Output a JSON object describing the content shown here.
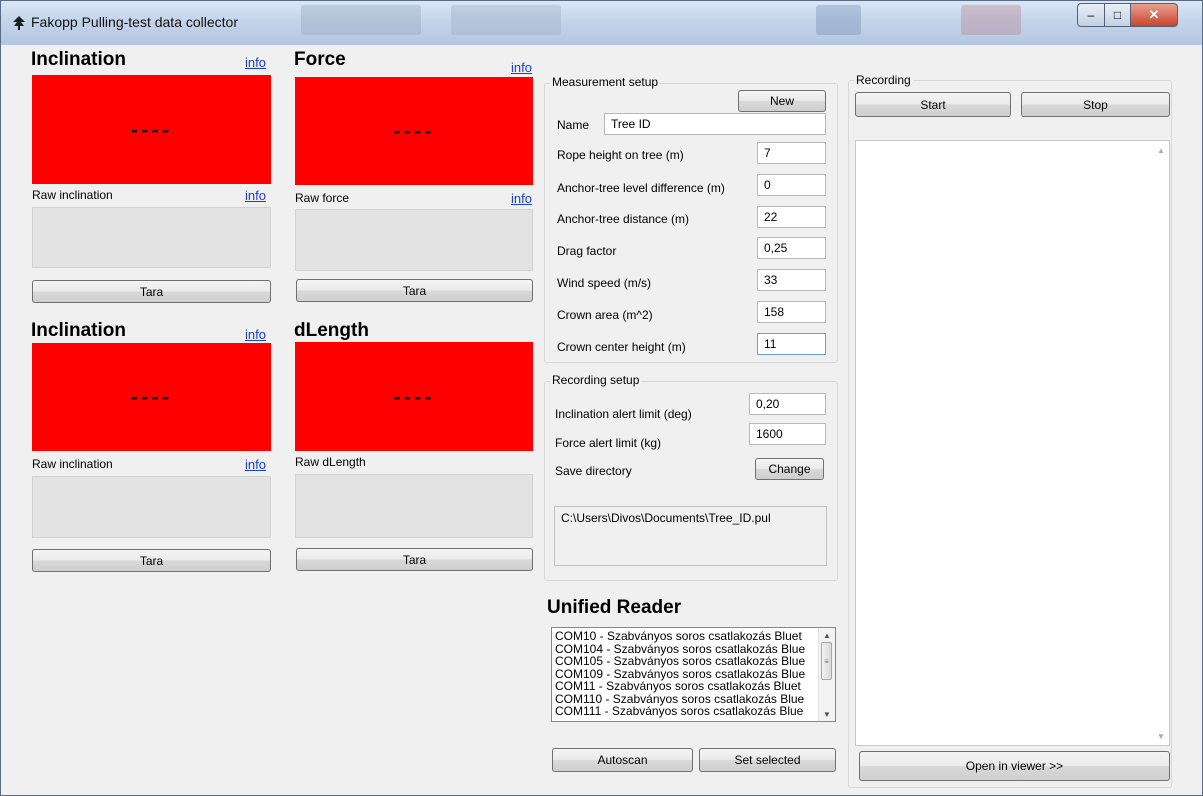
{
  "window": {
    "title": "Fakopp Pulling-test data collector",
    "controls": {
      "minimize": "–",
      "maximize": "□",
      "close": "✕"
    }
  },
  "panels": [
    {
      "title": "Inclination",
      "info": "info",
      "value": "----",
      "raw_label": "Raw inclination",
      "raw_info": "info",
      "tara": "Tara"
    },
    {
      "title": "Force",
      "info": "info",
      "value": "----",
      "raw_label": "Raw force",
      "raw_info": "info",
      "tara": "Tara"
    },
    {
      "title": "Inclination",
      "info": "info",
      "value": "----",
      "raw_label": "Raw inclination",
      "raw_info": "info",
      "tara": "Tara"
    },
    {
      "title": "dLength",
      "value": "----",
      "raw_label": "Raw dLength",
      "tara": "Tara"
    }
  ],
  "measurement_setup": {
    "title": "Measurement setup",
    "new_button": "New",
    "name_label": "Name",
    "name_value": "Tree ID",
    "fields": [
      {
        "label": "Rope height on tree (m)",
        "value": "7"
      },
      {
        "label": "Anchor-tree level difference (m)",
        "value": "0"
      },
      {
        "label": "Anchor-tree distance (m)",
        "value": "22"
      },
      {
        "label": "Drag factor",
        "value": "0,25"
      },
      {
        "label": "Wind speed (m/s)",
        "value": "33"
      },
      {
        "label": "Crown area (m^2)",
        "value": "158"
      },
      {
        "label": "Crown center height (m)",
        "value": "11"
      }
    ]
  },
  "recording_setup": {
    "title": "Recording setup",
    "fields": [
      {
        "label": "Inclination alert limit (deg)",
        "value": "0,20"
      },
      {
        "label": "Force alert limit (kg)",
        "value": "1600"
      }
    ],
    "save_directory_label": "Save directory",
    "change_button": "Change",
    "path": "C:\\Users\\Divos\\Documents\\Tree_ID.pul"
  },
  "unified_reader": {
    "title": "Unified Reader",
    "ports": [
      "COM10 - Szabványos soros csatlakozás Bluet",
      "COM104 - Szabványos soros csatlakozás Blue",
      "COM105 - Szabványos soros csatlakozás Blue",
      "COM109 - Szabványos soros csatlakozás Blue",
      "COM11 - Szabványos soros csatlakozás Bluet",
      "COM110 - Szabványos soros csatlakozás Blue",
      "COM111 - Szabványos soros csatlakozás Blue"
    ],
    "autoscan_button": "Autoscan",
    "set_selected_button": "Set selected"
  },
  "recording": {
    "title": "Recording",
    "start_button": "Start",
    "stop_button": "Stop",
    "open_viewer_button": "Open in viewer >>"
  },
  "colors": {
    "display_bg": "#ff0000",
    "link": "#1a3fd1",
    "window_bg": "#f0f0f0"
  }
}
